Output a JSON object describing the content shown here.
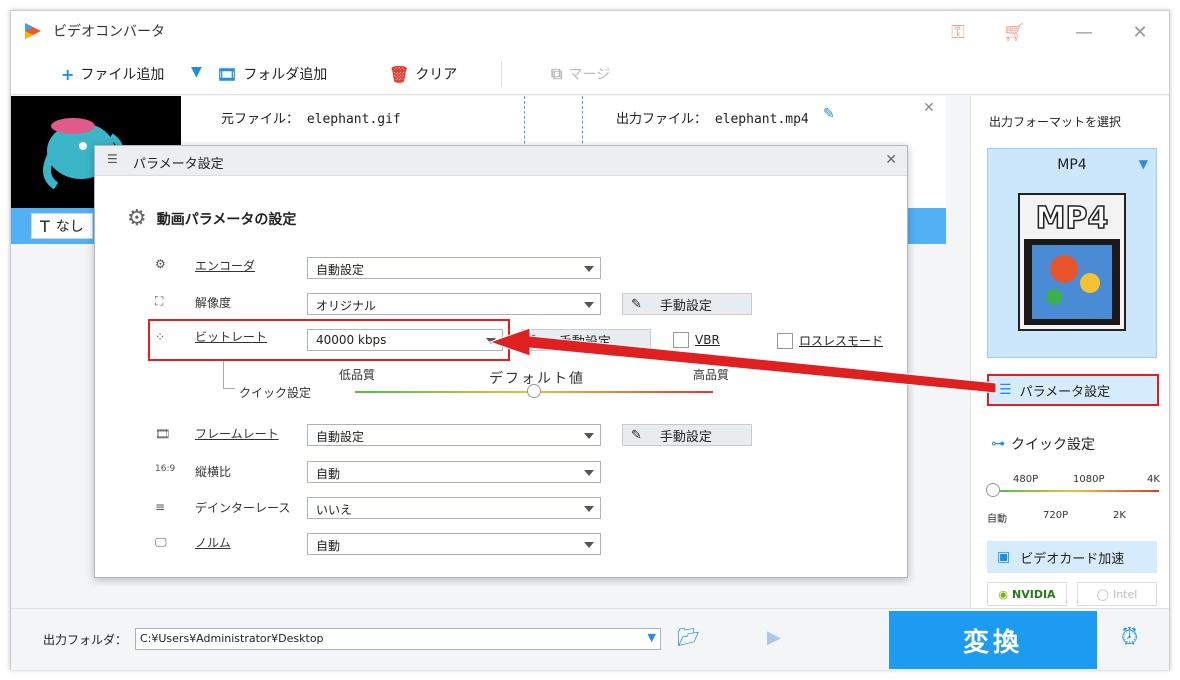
{
  "window": {
    "title": "ビデオコンバータ"
  },
  "toolbar": {
    "add_file": "ファイル追加",
    "add_folder": "フォルダ追加",
    "clear": "クリア",
    "merge": "マージ"
  },
  "file": {
    "source": "元ファイル： elephant.gif",
    "output": "出力ファイル： elephant.mp4",
    "subtitle": "なし"
  },
  "dialog": {
    "title": "パラメータ設定",
    "heading": "動画パラメータの設定",
    "rows": {
      "encoder": {
        "label": "エンコーダ",
        "value": "自動設定"
      },
      "resolution": {
        "label": "解像度",
        "value": "オリジナル",
        "manual": "手動設定"
      },
      "bitrate": {
        "label": "ビットレート",
        "value": "40000 kbps",
        "manual": "手動設定",
        "vbr": "VBR",
        "lossless": "ロスレスモード"
      },
      "quick": {
        "label": "クイック設定",
        "low": "低品質",
        "default": "デフォルト値",
        "high": "高品質",
        "level": 0.5
      },
      "framerate": {
        "label": "フレームレート",
        "value": "自動設定",
        "manual": "手動設定"
      },
      "aspect": {
        "label": "縦横比",
        "value": "自動"
      },
      "deinterlace": {
        "label": "デインターレース",
        "value": "いいえ"
      },
      "norm": {
        "label": "ノルム",
        "value": "自動"
      }
    }
  },
  "right": {
    "select_format": "出力フォーマットを選択",
    "format": "MP4",
    "format_card": "MP4",
    "param_button": "パラメータ設定",
    "quick_title": "クイック設定",
    "quick_top": [
      "480P",
      "1080P",
      "4K"
    ],
    "quick_bottom": [
      "自動",
      "720P",
      "2K"
    ],
    "quick_level": 0,
    "gpu_button": "ビデオカード加速",
    "nvidia": "NVIDIA",
    "intel": "Intel"
  },
  "bottom": {
    "output_label": "出力フォルダ：",
    "output_path": "C:¥Users¥Administrator¥Desktop",
    "convert": "変換"
  },
  "colors": {
    "accent": "#1d9bf0",
    "highlight": "#e02020",
    "subbar": "#52b1f4"
  }
}
